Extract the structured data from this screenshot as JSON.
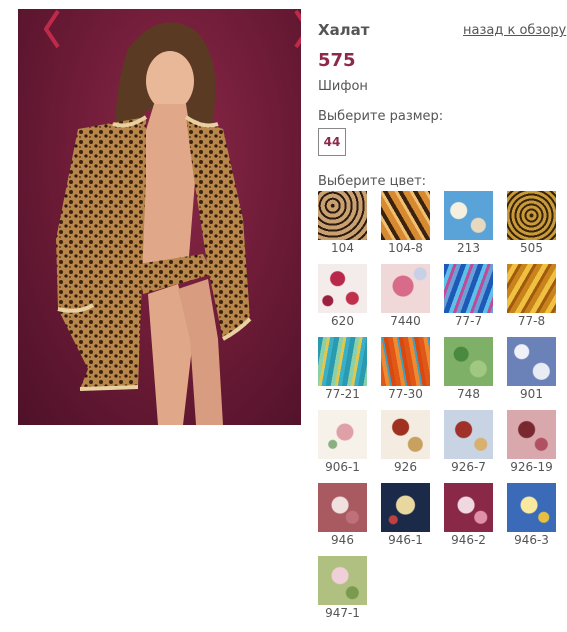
{
  "product": {
    "title": "Халат",
    "price": "575",
    "material": "Шифон",
    "back_link": "назад к обзору"
  },
  "size": {
    "label": "Выберите размер:",
    "options": [
      "44"
    ]
  },
  "colors": {
    "label": "Выберите цвет:",
    "swatches": [
      {
        "code": "104",
        "bg": "repeating-radial-gradient(circle at 30% 30%, #2b1a10 0 2px, #c9a070 2px 6px)"
      },
      {
        "code": "104-8",
        "bg": "repeating-linear-gradient(60deg, #3a2210 0 4px, #d88a30 4px 10px, #f0c070 10px 13px)"
      },
      {
        "code": "213",
        "bg": "radial-gradient(circle at 30% 40%, #f6f0e0 0 8px, transparent 9px), radial-gradient(circle at 70% 70%, #e8d8c0 0 7px, transparent 8px), #5aa3d8"
      },
      {
        "code": "505",
        "bg": "repeating-radial-gradient(circle at 50% 50%, #3a2408 0 2px, #c89a3a 2px 5px)"
      },
      {
        "code": "620",
        "bg": "radial-gradient(circle at 40% 30%, #b8284a 0 7px, transparent 8px), radial-gradient(circle at 70% 70%, #c0304c 0 6px, transparent 7px), radial-gradient(circle at 20% 75%, #9a2040 0 5px, transparent 6px), #f4ecea"
      },
      {
        "code": "7440",
        "bg": "radial-gradient(circle at 45% 45%, #d86a8a 0 10px, transparent 11px), radial-gradient(circle at 80% 20%, #c8d0e8 0 6px, transparent 7px), #f0d8d8"
      },
      {
        "code": "77-7",
        "bg": "repeating-linear-gradient(110deg, #1d5ab8 0 5px, #5ec0e8 5px 9px, #c04a9a 9px 12px, #6aa0d8 12px 16px)"
      },
      {
        "code": "77-8",
        "bg": "repeating-linear-gradient(120deg, #c8841a 0 5px, #f0c040 5px 10px, #a05a10 10px 13px)"
      },
      {
        "code": "77-21",
        "bg": "repeating-linear-gradient(100deg, #2a9ab0 0 5px, #8ad0a8 5px 9px, #e0c850 9px 12px, #3ab0c8 12px 16px)"
      },
      {
        "code": "77-30",
        "bg": "repeating-linear-gradient(80deg, #e05818 0 5px, #f08a30 5px 9px, #40a0c0 9px 11px, #d84810 11px 15px)"
      },
      {
        "code": "748",
        "bg": "radial-gradient(circle at 35% 35%, #4a8a40 0 7px, transparent 8px), radial-gradient(circle at 70% 65%, #a0c880 0 8px, transparent 9px), #7fb068"
      },
      {
        "code": "901",
        "bg": "radial-gradient(circle at 30% 30%, #f0f0f8 0 7px, transparent 8px), radial-gradient(circle at 70% 70%, #e8ecf4 0 8px, transparent 9px), #6a82b8"
      },
      {
        "code": "906-1",
        "bg": "radial-gradient(circle at 55% 45%, #e0a0a8 0 8px, transparent 9px), radial-gradient(circle at 30% 70%, #8ab080 0 4px, transparent 5px), #f6f2ea"
      },
      {
        "code": "926",
        "bg": "radial-gradient(circle at 40% 35%, #a03020 0 8px, transparent 9px), radial-gradient(circle at 70% 70%, #c8a060 0 7px, transparent 8px), #f4ece0"
      },
      {
        "code": "926-7",
        "bg": "radial-gradient(circle at 40% 40%, #a03028 0 8px, transparent 9px), radial-gradient(circle at 75% 70%, #d8b070 0 6px, transparent 7px), #c8d4e4"
      },
      {
        "code": "926-19",
        "bg": "radial-gradient(circle at 40% 40%, #7a2830 0 8px, transparent 9px), radial-gradient(circle at 70% 70%, #b05060 0 6px, transparent 7px), #d8a8ac"
      },
      {
        "code": "946",
        "bg": "radial-gradient(circle at 45% 45%, #f0e0e0 0 8px, transparent 9px), radial-gradient(circle at 70% 70%, #c0707a 0 6px, transparent 7px), #a85a60"
      },
      {
        "code": "946-1",
        "bg": "radial-gradient(circle at 50% 45%, #e8d8a0 0 9px, transparent 10px), radial-gradient(circle at 25% 75%, #c04040 0 4px, transparent 5px), #1c2a4a"
      },
      {
        "code": "946-2",
        "bg": "radial-gradient(circle at 45% 45%, #f0d8e0 0 8px, transparent 9px), radial-gradient(circle at 75% 70%, #e090a8 0 6px, transparent 7px), #8a2848"
      },
      {
        "code": "946-3",
        "bg": "radial-gradient(circle at 45% 45%, #f8e8a0 0 8px, transparent 9px), radial-gradient(circle at 75% 70%, #e8c040 0 5px, transparent 6px), #3a6ab8"
      },
      {
        "code": "947-1",
        "bg": "radial-gradient(circle at 45% 40%, #f0d0d8 0 8px, transparent 9px), radial-gradient(circle at 70% 75%, #7a9a50 0 6px, transparent 7px), #b0c080"
      }
    ]
  },
  "theme": {
    "accent": "#8b2a4c",
    "arrow": "#c02a4a",
    "photo_bg": "#6a1a35"
  }
}
